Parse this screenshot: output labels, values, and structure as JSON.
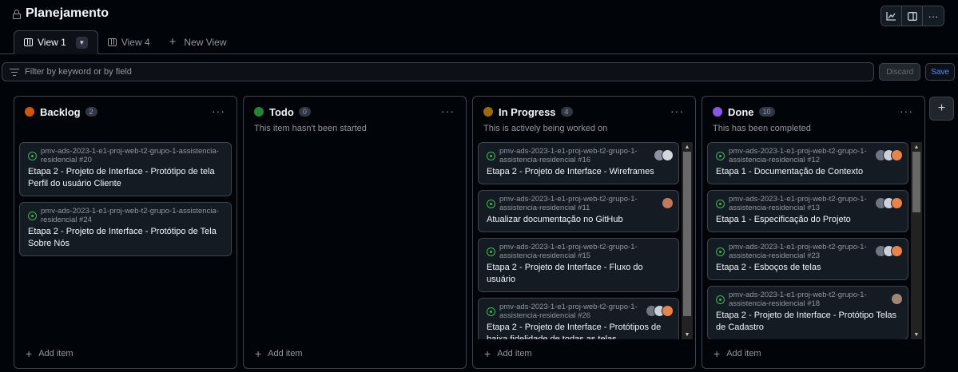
{
  "project": {
    "title": "Planejamento"
  },
  "header_actions": [
    {
      "icon": "graph-icon",
      "glyph": "📈"
    },
    {
      "icon": "sidebar-icon",
      "glyph": "◫"
    },
    {
      "icon": "kebab-icon",
      "glyph": "···"
    }
  ],
  "tabs": [
    {
      "label": "View 1",
      "active": true
    },
    {
      "label": "View 4",
      "active": false
    }
  ],
  "new_view_label": "New View",
  "filter": {
    "placeholder": "Filter by keyword or by field"
  },
  "buttons": {
    "discard": "Discard",
    "save": "Save"
  },
  "add_item_label": "Add item",
  "columns": [
    {
      "name": "Backlog",
      "count": "2",
      "color": "#d15704",
      "description": "",
      "cards": [
        {
          "repo": "pmv-ads-2023-1-e1-proj-web-t2-grupo-1-assistencia-residencial #20",
          "title": "Etapa 2 - Projeto de Interface - Protótipo de tela Perfil do usuário Cliente",
          "avatars": []
        },
        {
          "repo": "pmv-ads-2023-1-e1-proj-web-t2-grupo-1-assistencia-residencial #24",
          "title": "Etapa 2 - Projeto de Interface - Protótipo de Tela Sobre Nós",
          "avatars": []
        }
      ]
    },
    {
      "name": "Todo",
      "count": "0",
      "color": "#238636",
      "description": "This item hasn't been started",
      "cards": []
    },
    {
      "name": "In Progress",
      "count": "4",
      "color": "#9e6a03",
      "description": "This is actively being worked on",
      "cards": [
        {
          "repo": "pmv-ads-2023-1-e1-proj-web-t2-grupo-1-assistencia-residencial #16",
          "title": "Etapa 2 - Projeto de Interface - Wireframes",
          "avatars": [
            "#8b949e",
            "#d0d7de"
          ]
        },
        {
          "repo": "pmv-ads-2023-1-e1-proj-web-t2-grupo-1-assistencia-residencial #11",
          "title": "Atualizar documentação no GitHub",
          "avatars": [
            "#c2795b"
          ]
        },
        {
          "repo": "pmv-ads-2023-1-e1-proj-web-t2-grupo-1-assistencia-residencial #15",
          "title": "Etapa 2 - Projeto de Interface - Fluxo do usuário",
          "avatars": []
        },
        {
          "repo": "pmv-ads-2023-1-e1-proj-web-t2-grupo-1-assistencia-residencial #26",
          "title": "Etapa 2 - Projeto de Interface - Protótipos de baixa fidelidade de todas as telas",
          "avatars": [
            "#6e7681",
            "#c9d1d9",
            "#e8844a"
          ]
        }
      ]
    },
    {
      "name": "Done",
      "count": "10",
      "color": "#8957e5",
      "description": "This has been completed",
      "cards": [
        {
          "repo": "pmv-ads-2023-1-e1-proj-web-t2-grupo-1-assistencia-residencial #12",
          "title": "Etapa 1 - Documentação de Contexto",
          "avatars": [
            "#6e7681",
            "#c9d1d9",
            "#e8844a"
          ]
        },
        {
          "repo": "pmv-ads-2023-1-e1-proj-web-t2-grupo-1-assistencia-residencial #13",
          "title": "Etapa 1 - Especificação do Projeto",
          "avatars": [
            "#6e7681",
            "#c9d1d9",
            "#e8844a"
          ]
        },
        {
          "repo": "pmv-ads-2023-1-e1-proj-web-t2-grupo-1-assistencia-residencial #23",
          "title": "Etapa 2 - Esboços de telas",
          "avatars": [
            "#6e7681",
            "#c9d1d9",
            "#e8844a"
          ]
        },
        {
          "repo": "pmv-ads-2023-1-e1-proj-web-t2-grupo-1-assistencia-residencial #18",
          "title": "Etapa 2 - Projeto de Interface - Protótipo Telas de Cadastro",
          "avatars": [
            "#a08775"
          ]
        }
      ]
    }
  ]
}
